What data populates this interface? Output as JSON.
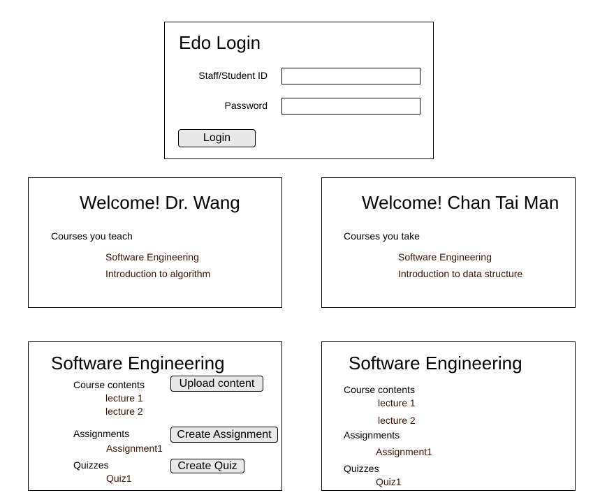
{
  "login": {
    "title": "Edo Login",
    "id_label": "Staff/Student ID",
    "id_value": "",
    "password_label": "Password",
    "password_value": "",
    "login_button": "Login"
  },
  "teacher_welcome": {
    "title": "Welcome! Dr. Wang",
    "section": "Courses you teach",
    "courses": [
      "Software Engineering",
      "Introduction to algorithm"
    ]
  },
  "student_welcome": {
    "title": "Welcome! Chan Tai Man",
    "section": "Courses you take",
    "courses": [
      "Software Engineering",
      "Introduction to data structure"
    ]
  },
  "teacher_course": {
    "title": "Software Engineering",
    "contents_label": "Course contents",
    "lectures": [
      "lecture 1",
      "lecture 2"
    ],
    "assignments_label": "Assignments",
    "assignments": [
      "Assignment1"
    ],
    "quizzes_label": "Quizzes",
    "quizzes": [
      "Quiz1"
    ],
    "upload_button": "Upload content",
    "create_assignment_button": "Create Assignment",
    "create_quiz_button": "Create Quiz"
  },
  "student_course": {
    "title": "Software Engineering",
    "contents_label": "Course contents",
    "lectures": [
      "lecture 1",
      "lecture 2"
    ],
    "assignments_label": "Assignments",
    "assignments": [
      "Assignment1"
    ],
    "quizzes_label": "Quizzes",
    "quizzes": [
      "Quiz1"
    ]
  }
}
